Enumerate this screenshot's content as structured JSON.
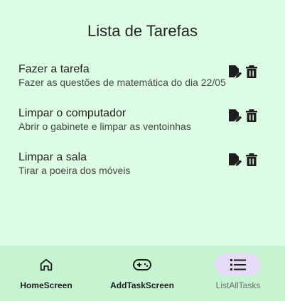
{
  "header": {
    "title": "Lista de Tarefas"
  },
  "tasks": [
    {
      "title": "Fazer a tarefa",
      "description": "Fazer as questões de matemática do dia 22/05"
    },
    {
      "title": "Limpar o computador",
      "description": "Abrir o gabinete e limpar as ventoinhas"
    },
    {
      "title": "Limpar a sala",
      "description": "Tirar a poeira dos móveis"
    }
  ],
  "icons": {
    "edit": "edit-note-icon",
    "delete": "trash-icon"
  },
  "nav": {
    "items": [
      {
        "label": "HomeScreen",
        "icon": "home-icon"
      },
      {
        "label": "AddTaskScreen",
        "icon": "gamepad-icon"
      },
      {
        "label": "ListAllTasks",
        "icon": "list-icon",
        "selected": true
      }
    ]
  },
  "colors": {
    "background": "#dcfde4",
    "navbar": "#c6f3d0",
    "selected_pill": "#e7dcf7"
  }
}
